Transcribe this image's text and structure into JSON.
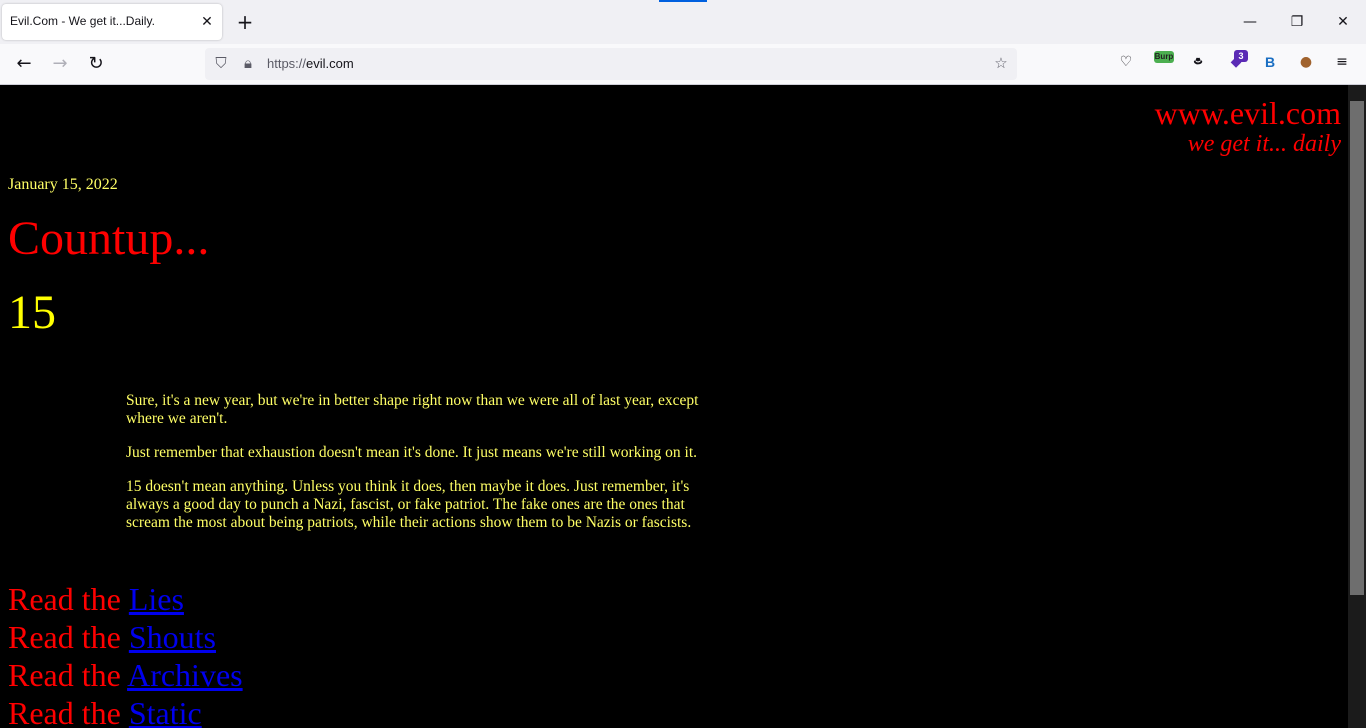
{
  "browser": {
    "tab_title": "Evil.Com - We get it...Daily.",
    "url_scheme": "https://",
    "url_host": "evil.com",
    "extension_badge_burp": "Burp",
    "extension_badge_count": "3",
    "extension_b_label": "B",
    "colors": {
      "tab_accent": "#0060df",
      "chrome_bg": "#f0f0f4"
    }
  },
  "site": {
    "title": "www.evil.com",
    "tagline": "we get it... daily"
  },
  "post": {
    "date": "January 15, 2022",
    "heading": "Countup...",
    "count": "15",
    "paragraphs": [
      "Sure, it's a new year, but we're in better shape right now than we were all of last year, except where we aren't.",
      "Just remember that exhaustion doesn't mean it's done. It just means we're still working on it.",
      "15 doesn't mean anything. Unless you think it does, then maybe it does. Just remember, it's always a good day to punch a Nazi, fascist, or fake patriot. The fake ones are the ones that scream the most about being patriots, while their actions show them to be Nazis or fascists."
    ]
  },
  "read_links": {
    "prefix": "Read the ",
    "items": [
      "Lies",
      "Shouts",
      "Archives",
      "Static"
    ]
  },
  "colors": {
    "background": "#000000",
    "heading_red": "#ff0000",
    "text_yellow": "#ffff66",
    "link_blue": "#0000ee"
  }
}
